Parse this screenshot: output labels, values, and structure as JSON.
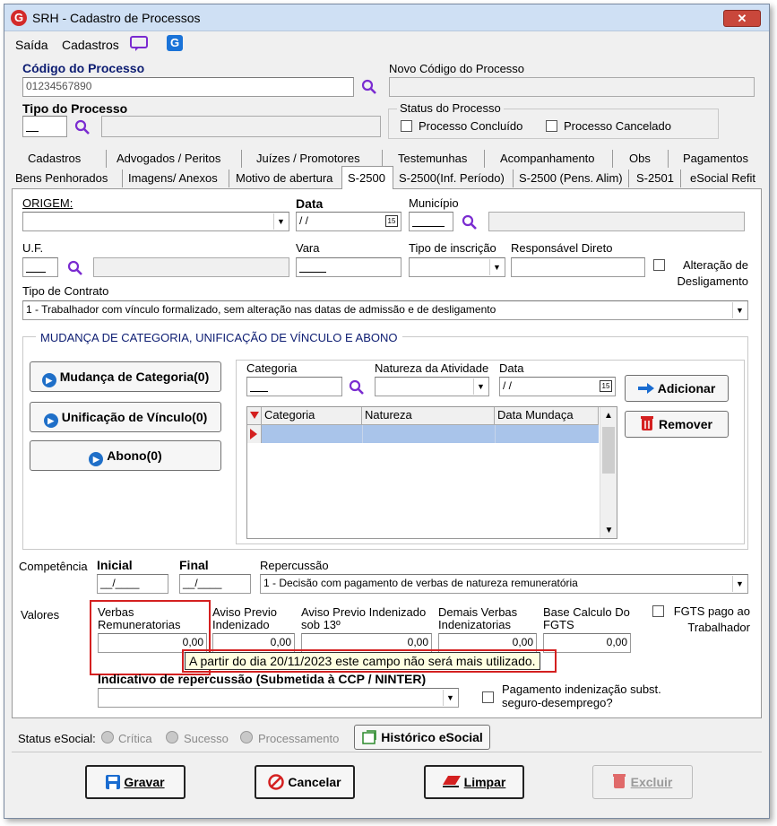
{
  "window": {
    "title": "SRH - Cadastro de Processos",
    "close": "✕"
  },
  "menu": {
    "saida": "Saída",
    "cadastros": "Cadastros"
  },
  "header": {
    "codigo_label": "Código do Processo",
    "codigo_value": "01234567890",
    "novo_codigo_label": "Novo Código do Processo",
    "tipo_label": "Tipo do Processo",
    "status_group": "Status do Processo",
    "concluido": "Processo Concluído",
    "cancelado": "Processo Cancelado"
  },
  "tabs_row1": [
    "Cadastros",
    "Advogados / Peritos",
    "Juízes / Promotores",
    "Testemunhas",
    "Acompanhamento",
    "Obs",
    "Pagamentos"
  ],
  "tabs_row2": [
    "Bens Penhorados",
    "Imagens/ Anexos",
    "Motivo de abertura",
    "S-2500",
    "S-2500(Inf. Período)",
    "S-2500 (Pens. Alim)",
    "S-2501",
    "eSocial Refit"
  ],
  "form": {
    "origem_label": "ORIGEM:",
    "data_label": "Data",
    "data_value": " / /",
    "municipio_label": "Município",
    "uf_label": "U.F.",
    "vara_label": "Vara",
    "tipo_inscricao_label": "Tipo de inscrição",
    "responsavel_label": "Responsável Direto",
    "alteracao_label": "Alteração de Desligamento",
    "tipo_contrato_label": "Tipo de Contrato",
    "tipo_contrato_value": "1 - Trabalhador com vínculo formalizado, sem alteração nas datas de admissão e de desligamento"
  },
  "mudanca": {
    "group_title": "MUDANÇA DE CATEGORIA, UNIFICAÇÃO DE VÍNCULO E ABONO",
    "btn_mudanca": "Mudança de Categoria(0)",
    "btn_unificacao": "Unificação de Vínculo(0)",
    "btn_abono": "Abono(0)",
    "categoria_label": "Categoria",
    "natureza_label": "Natureza da Atividade",
    "data_label": "Data",
    "data_value": " / /",
    "btn_adicionar": "Adicionar",
    "btn_remover": "Remover",
    "grid_columns": [
      "Categoria",
      "Natureza",
      "Data Mundaça"
    ]
  },
  "competencia": {
    "label": "Competência",
    "inicial_label": "Inicial",
    "inicial_value": "__/____",
    "final_label": "Final",
    "final_value": "__/____",
    "repercussao_label": "Repercussão",
    "repercussao_value": "1 - Decisão com pagamento de verbas de natureza remuneratória"
  },
  "valores": {
    "label": "Valores",
    "verbas_label": "Verbas Remuneratorias",
    "verbas_value": "0,00",
    "aviso_label": "Aviso Previo Indenizado",
    "aviso_value": "0,00",
    "aviso13_label": "Aviso Previo Indenizado sob 13º",
    "aviso13_value": "0,00",
    "demais_label": "Demais Verbas Indenizatorias",
    "demais_value": "0,00",
    "base_label": "Base Calculo Do FGTS",
    "base_value": "0,00",
    "fgts_label": "FGTS pago ao Trabalhador",
    "tooltip": "A partir do dia 20/11/2023 este campo não será mais utilizado.",
    "indicativo_label": "Indicativo de repercussão (Submetida à CCP / NINTER)",
    "pagamento_label": "Pagamento indenização subst. seguro-desemprego?"
  },
  "status_esocial": {
    "label": "Status eSocial:",
    "critica": "Crítica",
    "sucesso": "Sucesso",
    "processamento": "Processamento",
    "historico": "Histórico eSocial"
  },
  "footer": {
    "gravar": "Gravar",
    "cancelar": "Cancelar",
    "limpar": "Limpar",
    "excluir": "Excluir"
  },
  "colors": {
    "accent_red": "#d42020",
    "navy": "#0d1d72",
    "tooltip_bg": "#ffffe1",
    "selection": "#a9c4ea"
  }
}
